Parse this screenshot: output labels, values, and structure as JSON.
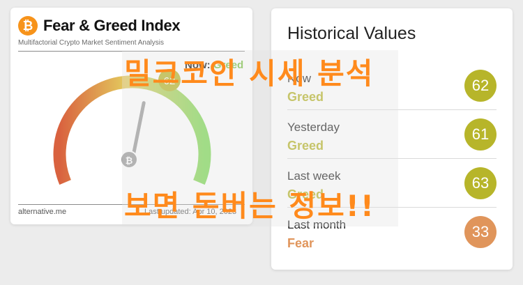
{
  "fear_greed_card": {
    "logo_glyph": "₿",
    "title": "Fear & Greed Index",
    "subtitle": "Multifactorial Crypto Market Sentiment Analysis",
    "now_label": "Now:",
    "now_classification": "Greed",
    "value": "62",
    "gauge_value_percent": 62,
    "source": "alternative.me",
    "last_updated": "Last updated: Apr 10, 2023",
    "needle_icon": "bitcoin-icon",
    "colors": {
      "fear": "#d9623f",
      "neutral": "#e3c85d",
      "greed": "#7ed957",
      "logo": "#f7931a"
    }
  },
  "historical": {
    "title": "Historical Values",
    "rows": [
      {
        "label": "Now",
        "classification": "Greed",
        "value": "62",
        "color": "#b7b52a"
      },
      {
        "label": "Yesterday",
        "classification": "Greed",
        "value": "61",
        "color": "#b7b52a"
      },
      {
        "label": "Last week",
        "classification": "Greed",
        "value": "63",
        "color": "#b7b52a"
      },
      {
        "label": "Last month",
        "classification": "Fear",
        "value": "33",
        "color": "#e0955b"
      }
    ]
  },
  "overlay": {
    "line1": "밀크코인 시세 분석",
    "line2": "보면 돈버는 정보!!",
    "color": "#ff8a1c"
  }
}
